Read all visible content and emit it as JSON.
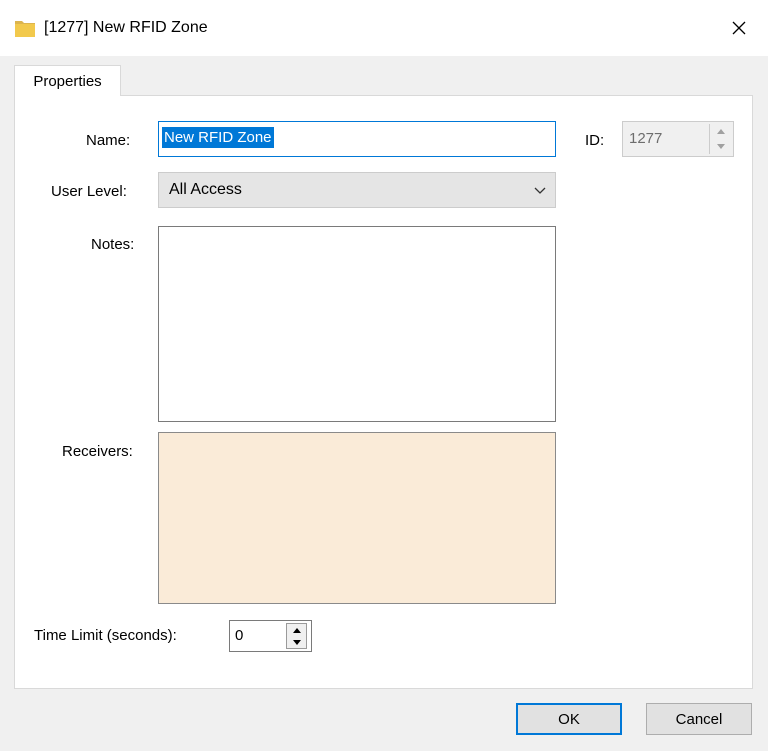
{
  "window": {
    "title": "[1277] New RFID Zone",
    "close_icon": "close-icon",
    "app_icon": "folder-icon"
  },
  "tabs": [
    {
      "label": "Properties",
      "selected": true
    }
  ],
  "form": {
    "name_label": "Name:",
    "name_value": "New RFID Zone",
    "id_label": "ID:",
    "id_value": "1277",
    "user_level_label": "User Level:",
    "user_level_value": "All Access",
    "notes_label": "Notes:",
    "notes_value": "",
    "receivers_label": "Receivers:",
    "time_limit_label": "Time Limit (seconds):",
    "time_limit_value": "0"
  },
  "buttons": {
    "ok": "OK",
    "cancel": "Cancel"
  },
  "colors": {
    "accent": "#0078d7",
    "receivers_bg": "#faebd8",
    "folder": "#f2c94c"
  }
}
